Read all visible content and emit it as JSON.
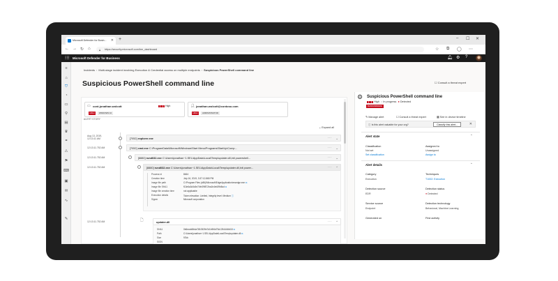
{
  "browser": {
    "tab_title": "Microsoft Defender for Busin...",
    "url": "https://security.microsoft.com/bm_dashboard",
    "win_controls": [
      "–",
      "☐",
      "✕"
    ]
  },
  "app": {
    "title": "Microsoft Defender for Business"
  },
  "breadcrumb": {
    "items": [
      "Incidents",
      "Multi-stage incident involving Execution & Credential access on multiple endpoints"
    ],
    "current": "Suspicious PowerShell command line"
  },
  "page": {
    "title": "Suspicious PowerShell command line",
    "consult_link": "Consult a threat expert"
  },
  "cards": [
    {
      "name": "cont-jonathan.wolcott",
      "risk": "High",
      "severity": "HIGH",
      "tag": "WINDOWS 10"
    },
    {
      "name": "jonathan.wolcott@contoso.com",
      "severity": "HIGH",
      "tag": "ADMINISTRATOR"
    }
  ],
  "story": {
    "label": "ALERT STORY",
    "expand_all": "Expand all",
    "rows": [
      {
        "time": [
          "Aug 13, 2019,",
          "12:13:11 AM"
        ],
        "pid": "[7052]",
        "proc": "explorer.exe",
        "args": ""
      },
      {
        "time": [
          "12:13:11.752 AM"
        ],
        "pid": "[7052]",
        "proc": "cmd.exe",
        "args": "C:\\ProgramData\\Microsoft\\Windows\\Start Menu\\Programs\\StartUp\\Comp..."
      },
      {
        "time": [
          "12:13:11.752 AM"
        ],
        "pid": "[8880]",
        "proc": "rundll32.exe",
        "args": "C:\\Users\\jonathan~1.SEL\\AppData\\Local\\Temp\\updater.dll,init powershell..."
      },
      {
        "time": [
          "12:13:11.752 AM"
        ],
        "pid": "[8880]",
        "proc": "rundll32.exe",
        "args": "C:\\Users\\jonathan~1.SEL\\AppData\\Local\\Temp\\updater.dll,init power..."
      }
    ],
    "details": [
      {
        "k": "Process id",
        "v": "8464"
      },
      {
        "k": "Creation time",
        "v": "July 16, 2019, 3:37:12.865 PM"
      },
      {
        "k": "Image file path",
        "v": "C:\\Program Files (x86)\\Microsoft\\EdgeApplication\\msedge.exe"
      },
      {
        "k": "Image file SHA1",
        "v": "f13e6a3c5c5e74fe39f872ba1b4eb39b8cd"
      },
      {
        "k": "Image file creation time",
        "v": "not applicable"
      },
      {
        "k": "Execution details",
        "v": "Token elevation: Limited, Integrity level: Medium"
      },
      {
        "k": "Signer",
        "v": "Microsoft corporation"
      }
    ],
    "file_row": {
      "time": "12:13:11.752 AM",
      "name": "updater.dll"
    },
    "file_details": [
      {
        "k": "SHA1",
        "v": "0b6ecdd8b4a7810539e7d1b9f4d75c1254444fd18"
      },
      {
        "k": "Path",
        "v": "C:\\Users\\jonathan~1.SEL\\AppData\\Local\\Temp\\updater.dll"
      },
      {
        "k": "Size",
        "v": "97kb"
      },
      {
        "k": "SIGN",
        "v": ""
      }
    ]
  },
  "alert": {
    "title": "Suspicious PowerShell command line",
    "severity": "High",
    "status": "In progress",
    "detection": "Detected",
    "badge": "RANSOMWARE",
    "actions": [
      "Manage alert",
      "Consult a threat expert",
      "See in device timeline"
    ],
    "classify_question": "Is this alert valuable for your org?",
    "classify_button": "Classify this alert...",
    "state_header": "Alert state",
    "state": [
      {
        "k": "Classification",
        "v": "Not set",
        "l": "Set classification"
      },
      {
        "k": "Assigned to",
        "v": "Unassigned",
        "l": "Assign to"
      }
    ],
    "details_header": "Alert details",
    "details": [
      {
        "k": "Category",
        "v": "Execution"
      },
      {
        "k": "Techniques",
        "v": "T1002: Execution"
      },
      {
        "k": "Detection source",
        "v": "EDR"
      },
      {
        "k": "Detection status",
        "v": "Detected"
      },
      {
        "k": "Service source",
        "v": "Endpoint"
      },
      {
        "k": "Detection technology",
        "v": "Behavioral, Machine Learning"
      },
      {
        "k": "Generated on",
        "v": ""
      },
      {
        "k": "First activity",
        "v": ""
      }
    ]
  },
  "colors": {
    "accent": "#0078d4",
    "severity": "#c50f1f",
    "appbar": "#1b1b1b",
    "device": "#1f1f1f"
  }
}
